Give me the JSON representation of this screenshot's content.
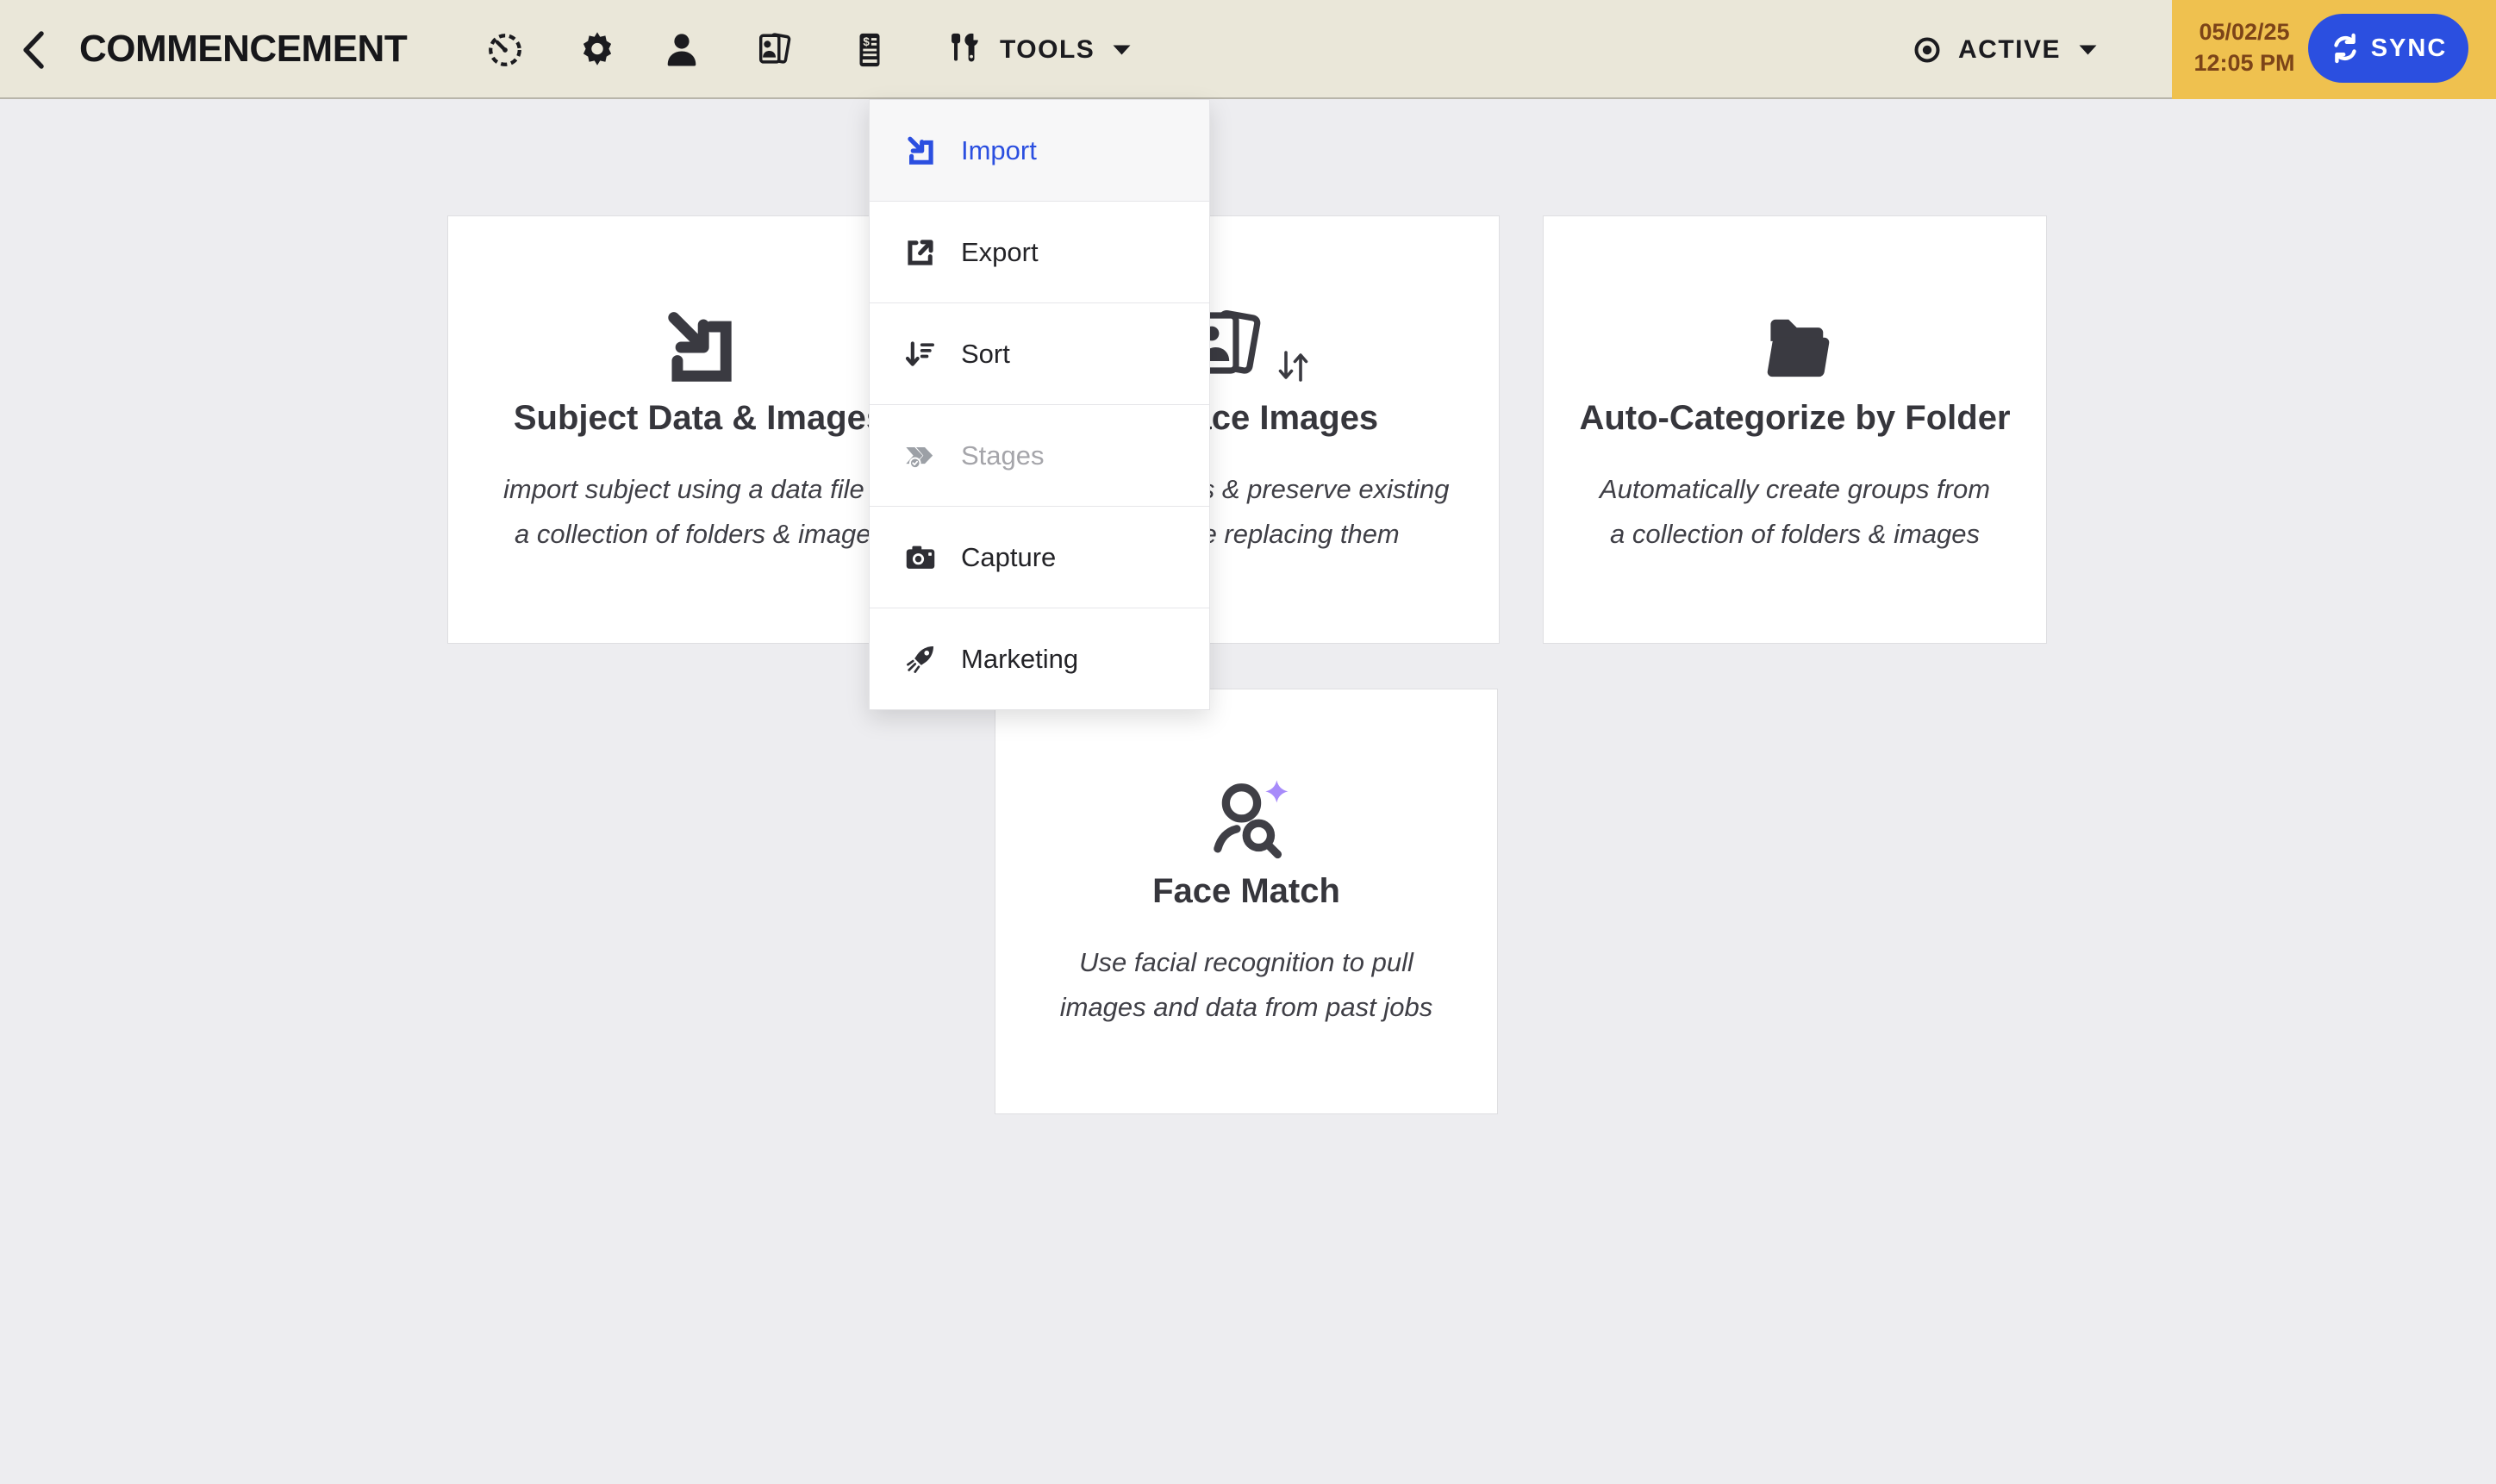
{
  "colors": {
    "topbar_bg": "#EAE7D9",
    "topbar_border": "#b8b5aa",
    "main_bg": "#ededf0",
    "card_bg": "#ffffff",
    "card_border": "#dedee1",
    "ink": "#1b1b1f",
    "card_title": "#36363c",
    "card_text": "#3f3f46",
    "accent_blue": "#2B4FE0",
    "sync_panel_orange": "#EFC14F",
    "sync_date_brown": "#7c4418",
    "disabled_gray": "#a5a5aa",
    "sparkle_purple": "#a78bfa"
  },
  "topbar": {
    "title": "COMMENCEMENT",
    "back_icon": "chevron-left-icon",
    "nav_icons": [
      "dashboard-gauge-icon",
      "settings-gear-icon",
      "subjects-person-icon",
      "images-photos-icon",
      "orders-invoice-icon"
    ],
    "tools": {
      "label": "TOOLS",
      "icon": "tools-icon",
      "caret": "chevron-down-icon"
    },
    "status": {
      "label": "ACTIVE",
      "icon": "eye-icon",
      "caret": "chevron-down-icon"
    },
    "sync": {
      "date": "05/02/25",
      "time": "12:05 PM",
      "button_label": "SYNC",
      "button_icon": "sync-refresh-icon"
    }
  },
  "tools_menu": {
    "items": [
      {
        "label": "Import",
        "icon": "import-icon",
        "state": "active"
      },
      {
        "label": "Export",
        "icon": "export-icon",
        "state": "default"
      },
      {
        "label": "Sort",
        "icon": "sort-icon",
        "state": "default"
      },
      {
        "label": "Stages",
        "icon": "stages-icon",
        "state": "disabled"
      },
      {
        "label": "Capture",
        "icon": "camera-icon",
        "state": "default"
      },
      {
        "label": "Marketing",
        "icon": "rocket-icon",
        "state": "default"
      }
    ]
  },
  "cards": [
    {
      "title": "Subject Data & Images",
      "icon": "import-icon",
      "desc_line1": "import subject using a data file or",
      "desc_line2": "a collection of folders & images"
    },
    {
      "title": "Replace Images",
      "icon": "replace-images-icon",
      "desc_line1": "import images & preserve existing",
      "desc_line2": "data while replacing them"
    },
    {
      "title": "Auto-Categorize by Folder",
      "icon": "folder-icon",
      "desc_line1": "Automatically create groups from",
      "desc_line2": "a collection of folders & images"
    },
    {
      "title": "Face Match",
      "icon": "face-match-icon",
      "desc_line1": "Use facial recognition to pull",
      "desc_line2": "images and data from past jobs"
    }
  ]
}
